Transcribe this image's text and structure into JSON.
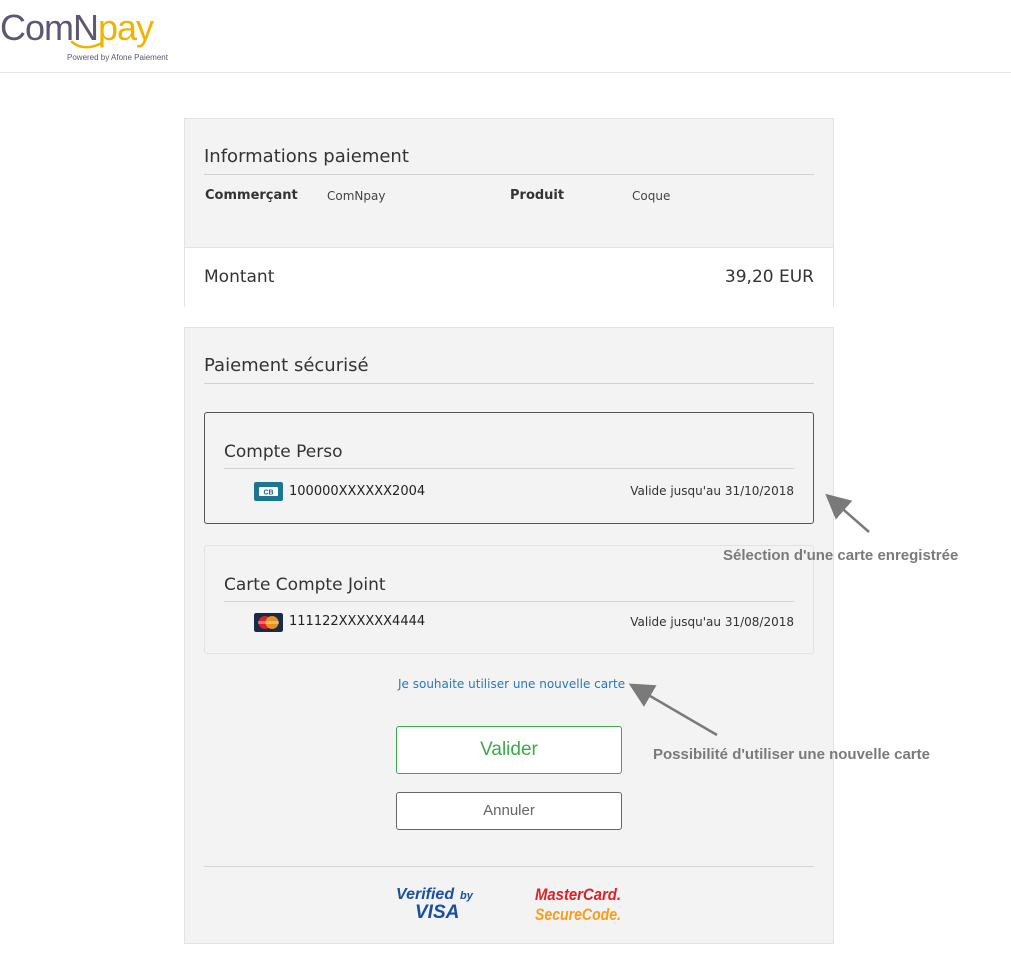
{
  "logo": {
    "part1": "ComN",
    "part2": "pay",
    "tagline": "Powered by Afone Paiement"
  },
  "info": {
    "title": "Informations paiement",
    "merchant_label": "Commerçant",
    "merchant_value": "ComNpay",
    "product_label": "Produit",
    "product_value": "Coque",
    "amount_label": "Montant",
    "amount_value": "39,20 EUR"
  },
  "payment": {
    "title": "Paiement sécurisé",
    "cards": [
      {
        "name": "Compte Perso",
        "type": "CB",
        "number": "100000XXXXXX2004",
        "expiry": "Valide jusqu'au 31/10/2018",
        "selected": true
      },
      {
        "name": "Carte Compte Joint",
        "type": "MasterCard",
        "number": "111122XXXXXX4444",
        "expiry": "Valide jusqu'au 31/08/2018",
        "selected": false
      }
    ],
    "new_card_link": "Je souhaite utiliser une nouvelle carte",
    "validate_label": "Valider",
    "cancel_label": "Annuler",
    "badges": {
      "visa_line1": "Verified",
      "visa_by": "by",
      "visa_line2": "VISA",
      "mc_line1": "MasterCard.",
      "mc_line2": "SecureCode."
    }
  },
  "annotations": {
    "saved_card": "Sélection d'une carte enregistrée",
    "new_card": "Possibilité d'utiliser une nouvelle carte"
  },
  "colors": {
    "accent_green": "#3ea84c",
    "link_blue": "#2a79b5",
    "logo_purple": "#5e5673",
    "logo_yellow": "#f0b400",
    "mc_red": "#d8232a",
    "mc_orange": "#f79e1b",
    "visa_blue": "#1a4fa0"
  }
}
